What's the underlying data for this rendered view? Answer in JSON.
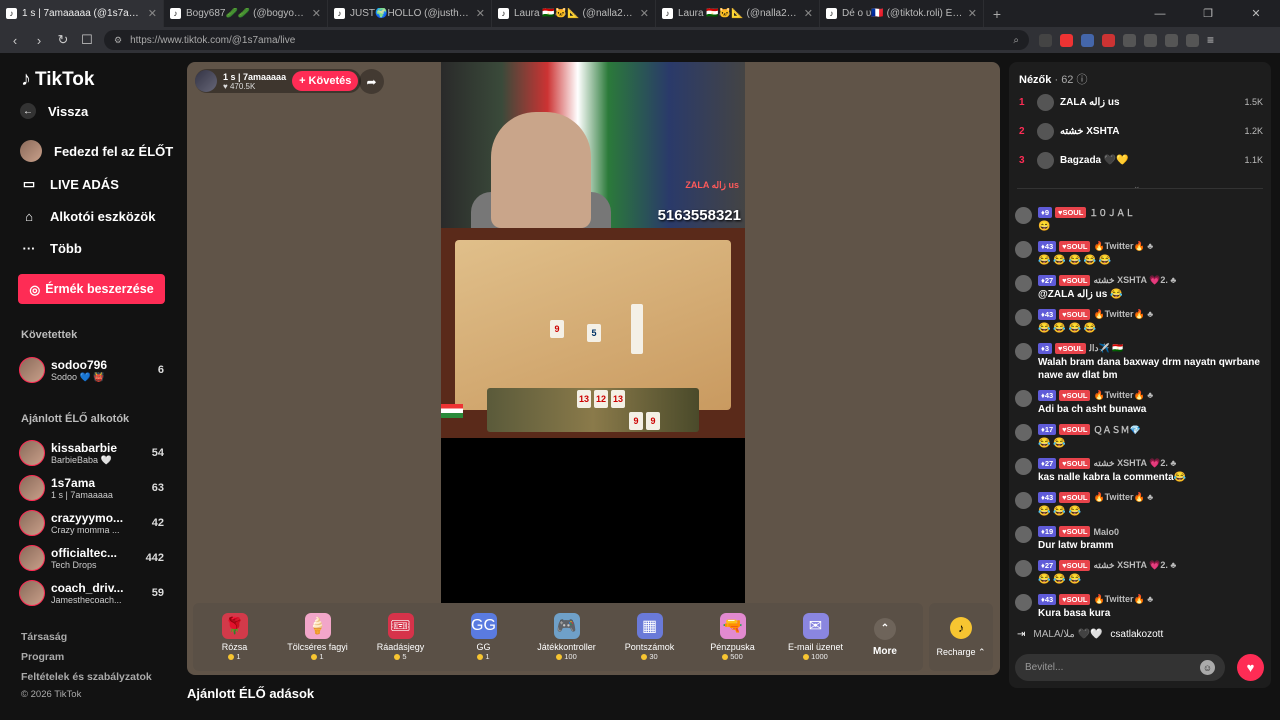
{
  "browser": {
    "tabs": [
      {
        "title": "1 s | 7amaaaaa (@1s7ama) ÉL",
        "active": true
      },
      {
        "title": "Bogy687🥒🥒 (@bogyo87__) ÉLŐ a"
      },
      {
        "title": "JUST🌍HOLLO (@justholloadam) ÉL"
      },
      {
        "title": "Laura 🇹🇯🐱📐 (@nalla2635) ÉLŐ adá"
      },
      {
        "title": "Laura 🇹🇯🐱📐 (@nalla2635) ÉLŐ adá"
      },
      {
        "title": "Dé o ᴜ🇫🇷 (@tiktok.roli) ÉLŐ adá"
      }
    ],
    "url": "https://www.tiktok.com/@1s7ama/live"
  },
  "sidebar": {
    "logo": "TikTok",
    "back": "Vissza",
    "explore": "Fedezd fel az ÉLŐT",
    "live": "LIVE ADÁS",
    "creator_tools": "Alkotói eszközök",
    "more": "Több",
    "coins_button": "Érmék beszerzése",
    "following_title": "Követettek",
    "following": [
      {
        "name": "sodoo796",
        "sub": "Sodoo 💙 👹",
        "count": "6"
      }
    ],
    "recommended_title": "Ajánlott ÉLŐ alkotók",
    "recommended": [
      {
        "name": "kissabarbie",
        "sub": "BarbieBaba 🤍",
        "count": "54"
      },
      {
        "name": "1s7ama",
        "sub": "1 s | 7amaaaaa",
        "count": "63"
      },
      {
        "name": "crazyyymo...",
        "sub": "Crazy momma ...",
        "count": "42"
      },
      {
        "name": "officialtec...",
        "sub": "Tech Drops",
        "count": "442"
      },
      {
        "name": "coach_driv...",
        "sub": "Jamesthecoach...",
        "count": "59"
      }
    ],
    "footer": [
      "Társaság",
      "Program",
      "Feltételek és szabályzatok"
    ],
    "copyright": "© 2026 TikTok"
  },
  "stream": {
    "name": "1 s | 7amaaaaa",
    "likes": "♥ 470.5K",
    "follow": "+ Követés",
    "score": "5163558321",
    "overlay_user": "ZALA ﺯاﻟﻪ us",
    "rack_tiles": [
      "13",
      "12",
      "13"
    ],
    "board_tiles": [
      "9",
      "5",
      "9",
      "9"
    ]
  },
  "gifts": [
    {
      "name": "Rózsa",
      "price": "1",
      "icon": "🌹",
      "color": "#d23a4a"
    },
    {
      "name": "Tölcséres fagyi",
      "price": "1",
      "icon": "🍦",
      "color": "#f2a6c9"
    },
    {
      "name": "Ráadásjegy",
      "price": "5",
      "icon": "🎟",
      "color": "#d6334a"
    },
    {
      "name": "GG",
      "price": "1",
      "icon": "GG",
      "color": "#5a7be0"
    },
    {
      "name": "Játékkontroller",
      "price": "100",
      "icon": "🎮",
      "color": "#6fa0c8"
    },
    {
      "name": "Pontszámok",
      "price": "30",
      "icon": "▦",
      "color": "#6a7ad8"
    },
    {
      "name": "Pénzpuska",
      "price": "500",
      "icon": "🔫",
      "color": "#e28ad0"
    },
    {
      "name": "E-mail üzenet",
      "price": "1000",
      "icon": "✉",
      "color": "#8a86e0"
    }
  ],
  "gift_more": "More",
  "recharge": "Recharge ⌃",
  "bottom_title": "Ajánlott ÉLŐ adások",
  "chat": {
    "viewers_label": "Nézők",
    "viewers_count": "· 62",
    "ranking": [
      {
        "rank": "1",
        "name": "ZALA ﺯاﻟﻪ us",
        "score": "1.5K"
      },
      {
        "rank": "2",
        "name": "ﺧﺸﺘﻪ XSHTA",
        "score": "1.2K"
      },
      {
        "rank": "3",
        "name": "Bagzada 🖤💛",
        "score": "1.1K"
      }
    ],
    "messages": [
      {
        "lvl": "9",
        "fan": "SOUL",
        "user": "１０ＪＡＬ",
        "text": "😄"
      },
      {
        "lvl": "43",
        "fan": "SOUL",
        "user": "🔥Twitter🔥 ♣",
        "text": "😂 😂 😂 😂 😂"
      },
      {
        "lvl": "27",
        "fan": "SOUL",
        "user": "ﺧﺸﺘﻪ XSHTA 💗2. ♣",
        "text": "@ZALA ﺯاﻟﻪ us 😂"
      },
      {
        "lvl": "43",
        "fan": "SOUL",
        "user": "🔥Twitter🔥 ♣",
        "text": "😂 😂 😂 😂"
      },
      {
        "lvl": "3",
        "fan": "SOUL",
        "user": "ﺩاﻟ✈️ 🇹🇯",
        "text": "Walah bram dana baxway drm nayatn qwrbane nawe aw dlat bm"
      },
      {
        "lvl": "43",
        "fan": "SOUL",
        "user": "🔥Twitter🔥 ♣",
        "text": "Adi ba ch asht bunawa"
      },
      {
        "lvl": "17",
        "fan": "SOUL",
        "user": "ＱＡＳＭ💎",
        "text": "😂 😂"
      },
      {
        "lvl": "27",
        "fan": "SOUL",
        "user": "ﺧﺸﺘﻪ XSHTA 💗2. ♣",
        "text": "kas nalle kabra la commenta😂"
      },
      {
        "lvl": "43",
        "fan": "SOUL",
        "user": "🔥Twitter🔥 ♣",
        "text": "😂 😂 😂"
      },
      {
        "lvl": "19",
        "fan": "SOUL",
        "user": "Malo0",
        "text": "Dur latw bramm"
      },
      {
        "lvl": "27",
        "fan": "SOUL",
        "user": "ﺧﺸﺘﻪ XSHTA 💗2. ♣",
        "text": "😂 😂 😂"
      },
      {
        "lvl": "43",
        "fan": "SOUL",
        "user": "🔥Twitter🔥 ♣",
        "text": "Kura basa kura"
      }
    ],
    "join_user": "MALA/ﻣﻼ 🖤🤍",
    "join_text": "csatlakozott",
    "input_placeholder": "Bevitel..."
  }
}
